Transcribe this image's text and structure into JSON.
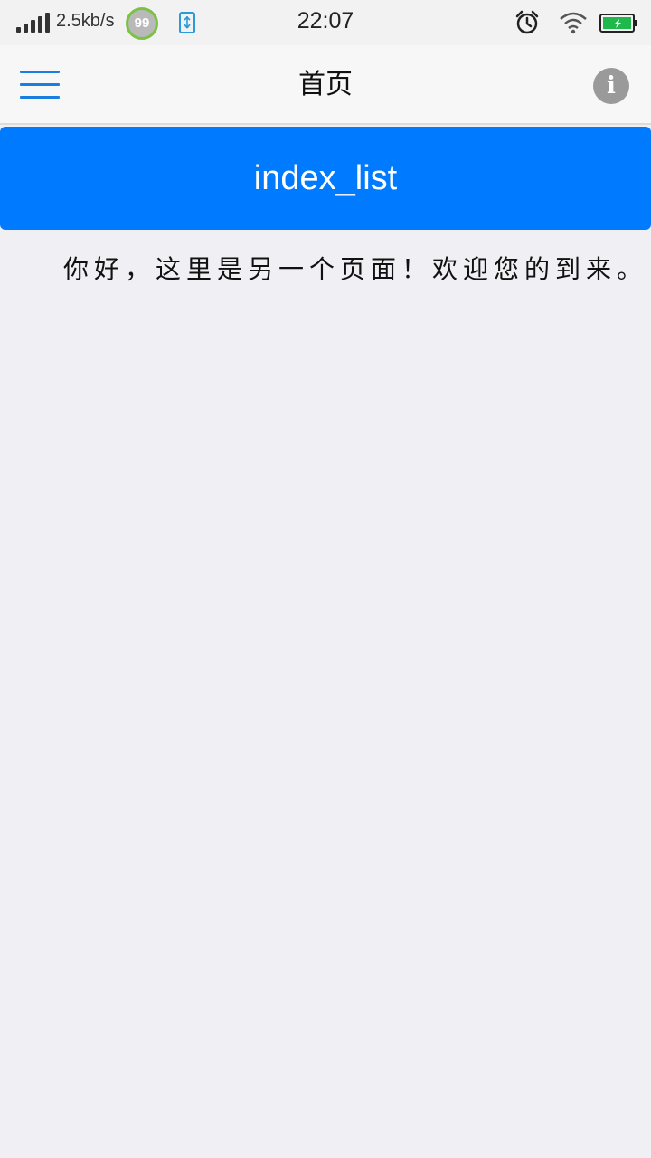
{
  "status_bar": {
    "network_speed": "2.5kb/s",
    "badge_value": "99",
    "time": "22:07",
    "colors": {
      "badge_ring": "#7cc242",
      "battery_fill": "#1fb84a",
      "usb": "#2a9ad8"
    },
    "icons": [
      "signal-icon",
      "usb-icon",
      "alarm-icon",
      "wifi-icon",
      "battery-charging-icon"
    ]
  },
  "nav": {
    "title": "首页",
    "menu_icon": "hamburger-menu-icon",
    "info_label": "i",
    "accent": "#1a7de0"
  },
  "banner": {
    "label": "index_list",
    "color": "#007aff"
  },
  "content": {
    "message": "你好，这里是另一个页面！欢迎您的到来。"
  }
}
